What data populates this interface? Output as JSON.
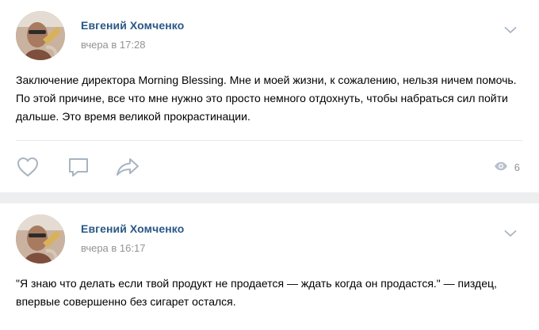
{
  "posts": [
    {
      "author": "Евгений Хомченко",
      "date": "вчера в 17:28",
      "text": "Заключение директора Morning Blessing. Мне и моей жизни, к сожалению, нельзя ничем помочь. По этой причине, все что мне нужно это просто немного отдохнуть, чтобы набраться сил пойти дальше. Это время великой прокрастинации.",
      "views": "6",
      "icons": [
        "heart-icon",
        "comment-icon",
        "share-icon",
        "eye-icon",
        "chevron-down-icon"
      ]
    },
    {
      "author": "Евгений Хомченко",
      "date": "вчера в 16:17",
      "text": "\"Я знаю что делать если твой продукт не продается — ждать когда он продастся.\" — пиздец, впервые совершенно без сигарет остался.",
      "icons": [
        "chevron-down-icon"
      ]
    }
  ],
  "colors": {
    "author_link": "#2a5885",
    "meta_gray": "#939393",
    "icon_gray": "#a9b4c1",
    "background": "#edeef0",
    "card": "#ffffff"
  }
}
